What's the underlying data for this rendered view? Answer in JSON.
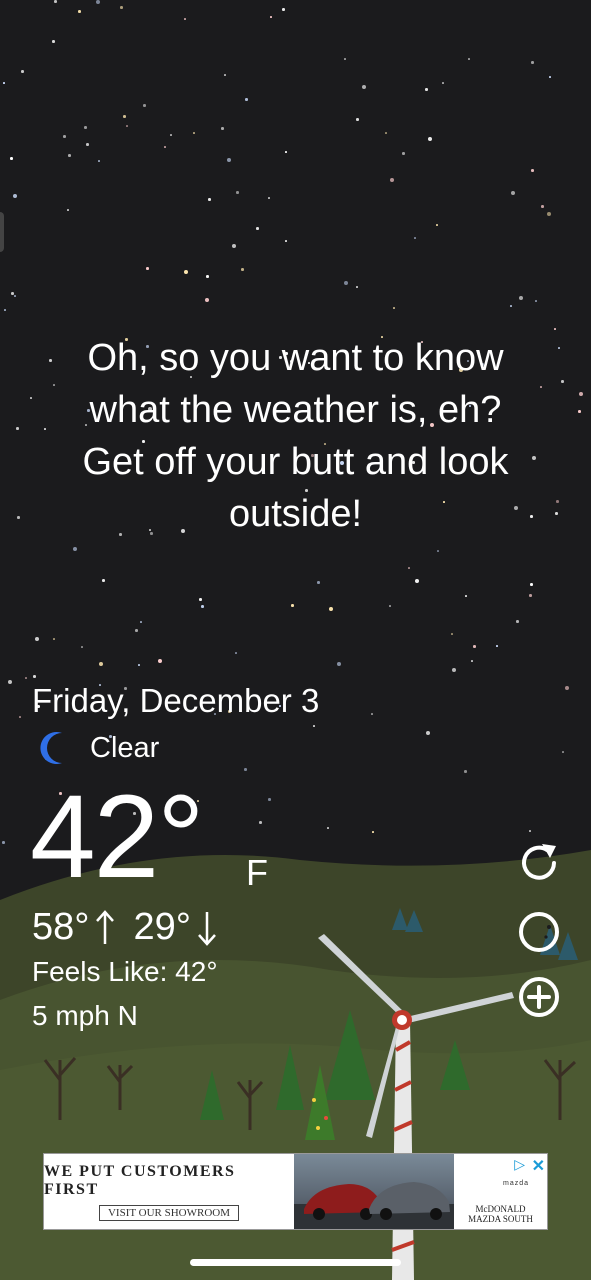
{
  "message": {
    "line1": "Oh, so you want to know",
    "line2": "what the weather is, eh?",
    "line3": "Get off your butt and look",
    "line4": "outside!"
  },
  "weather": {
    "date": "Friday, December 3",
    "condition_icon": "moon-icon",
    "condition": "Clear",
    "temperature": "42°",
    "unit": "F",
    "high": "58°",
    "low": "29°",
    "feels_like": "Feels Like: 42°",
    "wind": "5 mph N"
  },
  "actions": {
    "refresh_icon": "refresh-icon",
    "moon_phase_icon": "moon-phase-icon",
    "add_icon": "add-icon"
  },
  "ad": {
    "headline": "WE PUT CUSTOMERS FIRST",
    "cta": "VISIT OUR SHOWROOM",
    "dealer_line1": "McDONALD",
    "dealer_line2": "MAZDA SOUTH",
    "brand": "mazda"
  },
  "colors": {
    "background": "#1b1b1d",
    "hill": "#3f4a2a",
    "moon": "#2f6fe6",
    "ad_close": "#1a9bd7"
  }
}
